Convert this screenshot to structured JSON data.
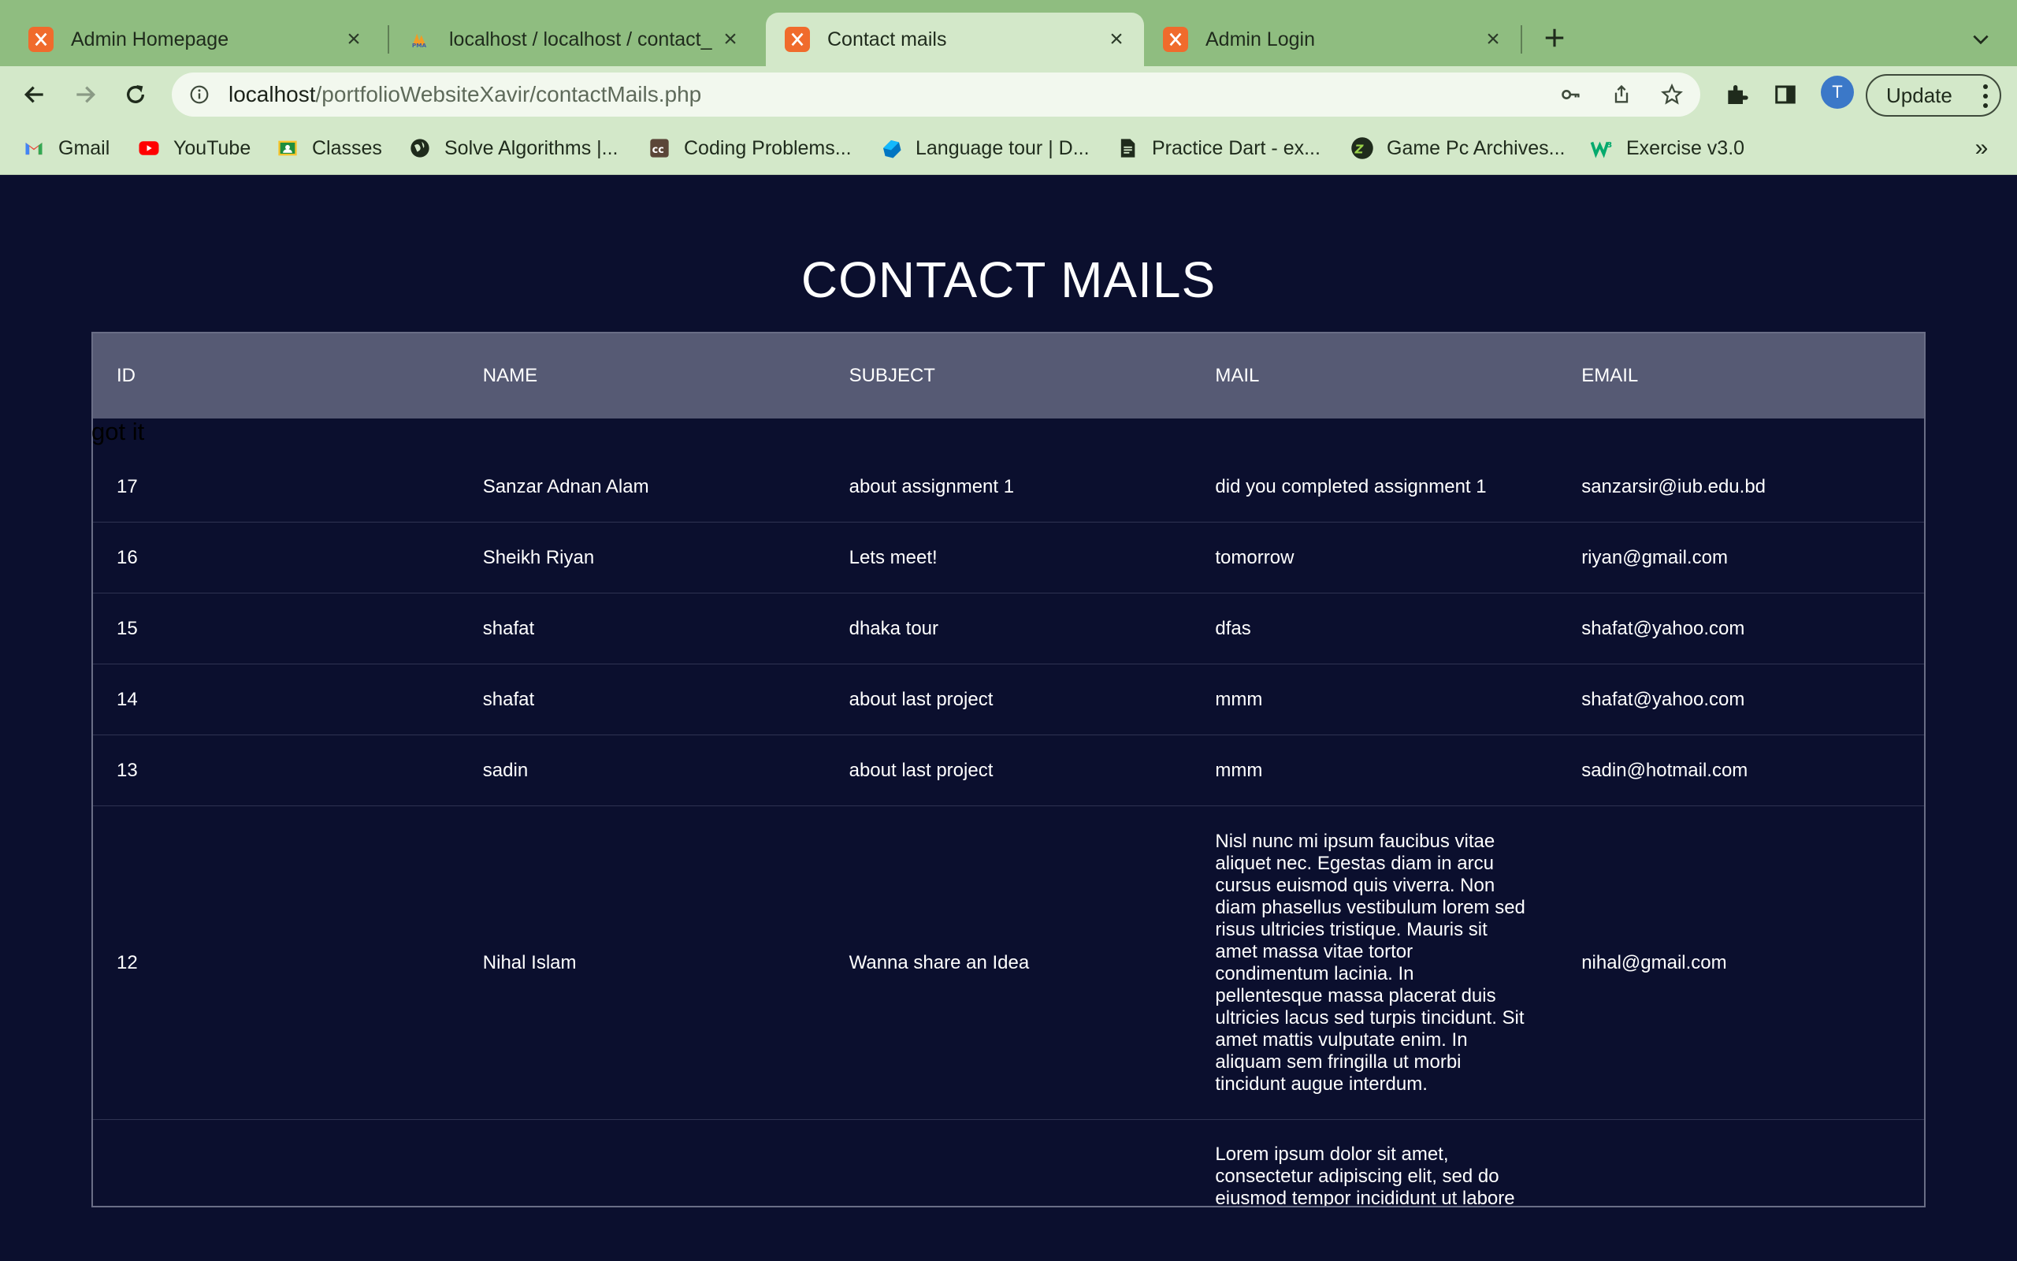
{
  "browser": {
    "tabs": [
      {
        "title": "Admin Homepage",
        "icon": "xampp-icon",
        "active": false
      },
      {
        "title": "localhost / localhost / contact_",
        "icon": "phpmyadmin-icon",
        "active": false
      },
      {
        "title": "Contact mails",
        "icon": "xampp-icon",
        "active": true
      },
      {
        "title": "Admin Login",
        "icon": "xampp-icon",
        "active": false
      }
    ],
    "url_host": "localhost",
    "url_path": "/portfolioWebsiteXavir/contactMails.php",
    "profile_initial": "T",
    "update_label": "Update",
    "bookmarks": [
      {
        "label": "Gmail",
        "icon": "gmail-icon"
      },
      {
        "label": "YouTube",
        "icon": "youtube-icon"
      },
      {
        "label": "Classes",
        "icon": "classroom-icon"
      },
      {
        "label": "Solve Algorithms |...",
        "icon": "globe-icon"
      },
      {
        "label": "Coding Problems...",
        "icon": "codechef-icon"
      },
      {
        "label": "Language tour | D...",
        "icon": "dart-icon"
      },
      {
        "label": "Practice Dart - ex...",
        "icon": "document-icon"
      },
      {
        "label": "Game Pc Archives...",
        "icon": "zz-icon"
      },
      {
        "label": "Exercise v3.0",
        "icon": "w3-icon"
      }
    ],
    "colors": {
      "frame": "#8fbd80",
      "toolbar": "#d3e8c9",
      "xampp": "#f06b2c"
    }
  },
  "page": {
    "title": "CONTACT MAILS",
    "stray_text": "got it",
    "headers": [
      "ID",
      "NAME",
      "SUBJECT",
      "MAIL",
      "EMAIL"
    ],
    "rows": [
      {
        "id": "17",
        "name": "Sanzar Adnan Alam",
        "subject": "about assignment 1",
        "mail": "did you completed assignment 1",
        "email": "sanzarsir@iub.edu.bd"
      },
      {
        "id": "16",
        "name": "Sheikh Riyan",
        "subject": "Lets meet!",
        "mail": "tomorrow",
        "email": "riyan@gmail.com"
      },
      {
        "id": "15",
        "name": "shafat",
        "subject": "dhaka tour",
        "mail": "dfas",
        "email": "shafat@yahoo.com"
      },
      {
        "id": "14",
        "name": "shafat",
        "subject": "about last project",
        "mail": "mmm",
        "email": "shafat@yahoo.com"
      },
      {
        "id": "13",
        "name": "sadin",
        "subject": "about last project",
        "mail": "mmm",
        "email": "sadin@hotmail.com"
      },
      {
        "id": "12",
        "name": "Nihal Islam",
        "subject": "Wanna share an Idea",
        "mail": "Nisl nunc mi ipsum faucibus vitae aliquet nec. Egestas diam in arcu cursus euismod quis viverra. Non diam phasellus vestibulum lorem sed risus ultricies tristique. Mauris sit amet massa vitae tortor condimentum lacinia. In pellentesque massa placerat duis ultricies lacus sed turpis tincidunt. Sit amet mattis vulputate enim. In aliquam sem fringilla ut morbi tincidunt augue interdum.",
        "email": "nihal@gmail.com"
      },
      {
        "id": "",
        "name": "",
        "subject": "",
        "mail": "Lorem ipsum dolor sit amet, consectetur adipiscing elit, sed do eiusmod tempor incididunt ut labore",
        "email": ""
      }
    ],
    "colors": {
      "background": "#0b0f2e",
      "header": "#565a74",
      "text": "#ffffff"
    }
  }
}
